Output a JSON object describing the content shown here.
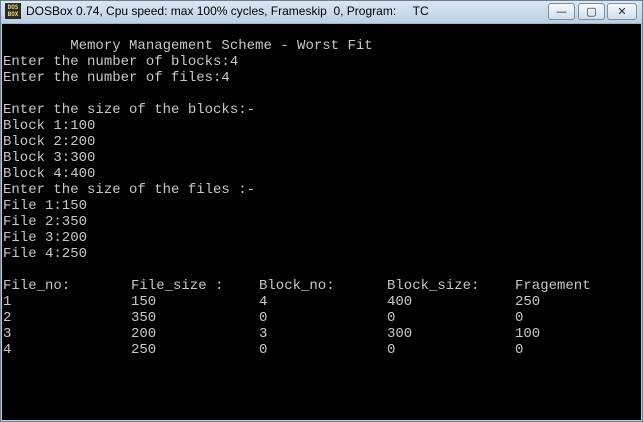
{
  "window": {
    "title": "DOSBox 0.74, Cpu speed: max 100% cycles, Frameskip  0, Program:     TC",
    "icon_label": "DOS BOX",
    "buttons": {
      "minimize": "—",
      "maximize": "▢",
      "close": "✕"
    }
  },
  "console": {
    "heading": "        Memory Management Scheme - Worst Fit",
    "prompt_blocks": "Enter the number of blocks:4",
    "prompt_files": "Enter the number of files:4",
    "blocks_prompt": "Enter the size of the blocks:-",
    "blocks": [
      "Block 1:100",
      "Block 2:200",
      "Block 3:300",
      "Block 4:400"
    ],
    "files_prompt": "Enter the size of the files :-",
    "files": [
      "File 1:150",
      "File 2:350",
      "File 3:200",
      "File 4:250"
    ],
    "table": {
      "headers": [
        "File_no:",
        "File_size :",
        "Block_no:",
        "Block_size:",
        "Fragement"
      ],
      "rows": [
        [
          "1",
          "150",
          "4",
          "400",
          "250"
        ],
        [
          "2",
          "350",
          "0",
          "0",
          "0"
        ],
        [
          "3",
          "200",
          "3",
          "300",
          "100"
        ],
        [
          "4",
          "250",
          "0",
          "0",
          "0"
        ]
      ]
    }
  }
}
